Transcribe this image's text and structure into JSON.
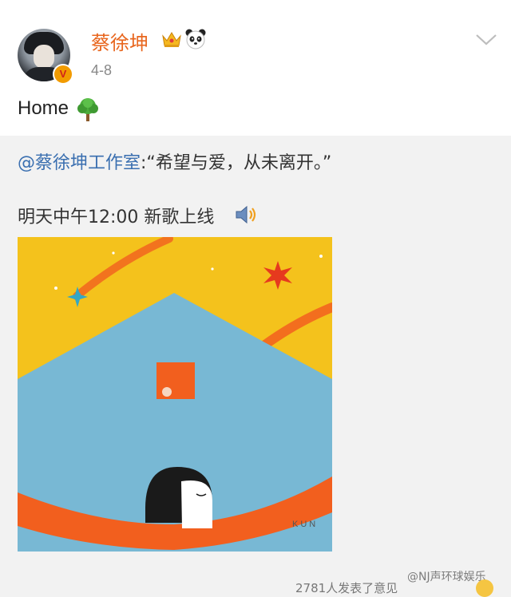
{
  "post": {
    "username": "蔡徐坤",
    "date": "4-8",
    "text": "Home",
    "verified_badge": "V"
  },
  "repost": {
    "mention": "@蔡徐坤工作室",
    "quote": ":“希望与爱，从未离开。”"
  },
  "announcement": {
    "text": "明天中午12:00  新歌上线"
  },
  "artwork": {
    "signature": "KUN"
  },
  "footer": {
    "partial_text": "2781人发表了意见",
    "watermark": "@NJ声环球娱乐"
  },
  "icons": [
    "crown-icon",
    "panda-icon",
    "chevron-down-icon",
    "tree-icon",
    "speaker-icon"
  ],
  "colors": {
    "username": "#e8661e",
    "link": "#3a6fb0",
    "art_yellow": "#f4c21c",
    "art_blue": "#78b8d4",
    "art_orange": "#f25f1e"
  }
}
